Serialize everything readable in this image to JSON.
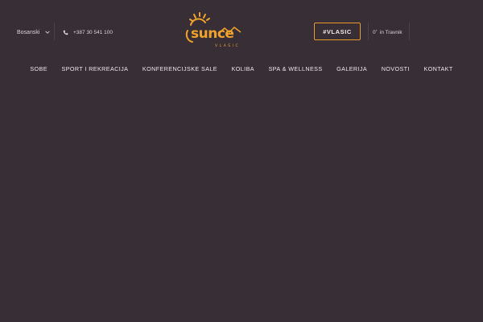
{
  "header": {
    "language": {
      "label": "Bosanski",
      "icon": "chevron-down-icon"
    },
    "phone": {
      "label": "+387 30 541 100",
      "icon": "phone-icon"
    },
    "logo": {
      "brand": "sunce",
      "sub": "VLAŠIĆ",
      "color": "#f0a22c"
    },
    "hashtag_button": "#VLASIC",
    "weather": {
      "temp": "0˚",
      "location": "in Travnik"
    }
  },
  "nav": {
    "items": [
      "SOBE",
      "SPORT I REKREACIJA",
      "KONFERENCIJSKE SALE",
      "KOLIBA",
      "SPA & WELLNESS",
      "GALERIJA",
      "NOVOSTI",
      "KONTAKT"
    ]
  },
  "colors": {
    "background": "#372f35",
    "accent": "#e89a2e",
    "text": "#ece7ea"
  }
}
